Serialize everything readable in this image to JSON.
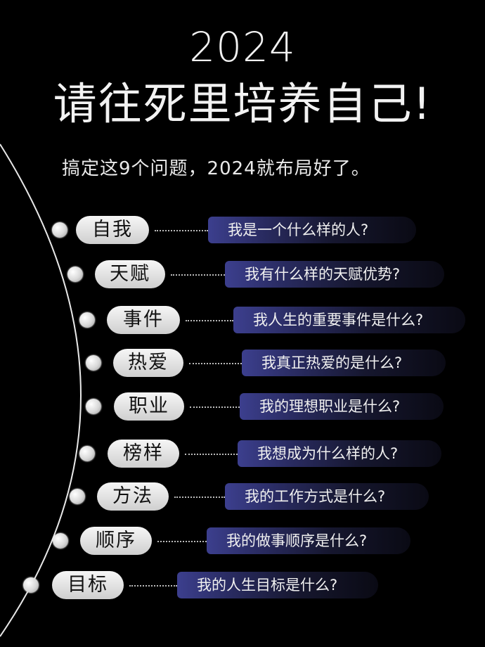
{
  "header": {
    "year": "2024",
    "title": "请往死里培养自己!",
    "subtitle": "搞定这9个问题，2024就布局好了。"
  },
  "items": [
    {
      "label": "自我",
      "question": "我是一个什么样的人?"
    },
    {
      "label": "天赋",
      "question": "我有什么样的天赋优势?"
    },
    {
      "label": "事件",
      "question": "我人生的重要事件是什么?"
    },
    {
      "label": "热爱",
      "question": "我真正热爱的是什么?"
    },
    {
      "label": "职业",
      "question": "我的理想职业是什么?"
    },
    {
      "label": "榜样",
      "question": "我想成为什么样的人?"
    },
    {
      "label": "方法",
      "question": "我的工作方式是什么?"
    },
    {
      "label": "顺序",
      "question": "我的做事顺序是什么?"
    },
    {
      "label": "目标",
      "question": "我的人生目标是什么?"
    }
  ],
  "colors": {
    "background": "#000000",
    "question_bar": "#3c3f8e",
    "pill": "#e6e6e6"
  }
}
